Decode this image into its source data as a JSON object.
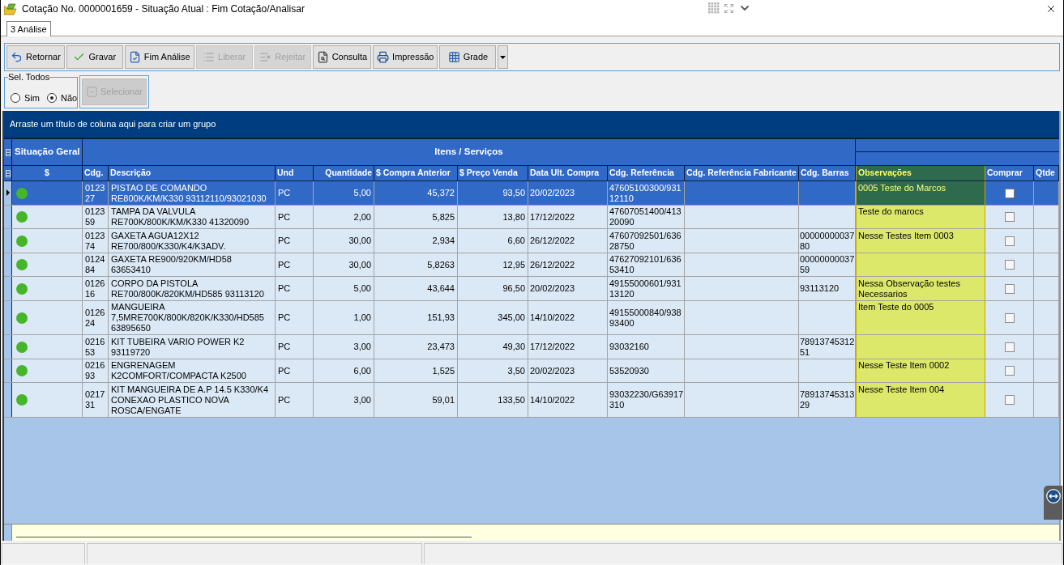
{
  "window": {
    "title": "Cotação No. 0000001659 - Situação Atual : Fim Cotação/Analisar"
  },
  "tabs": [
    {
      "label": "3 Análise",
      "selected": true
    }
  ],
  "toolbar": {
    "buttons": [
      {
        "label": "Retornar",
        "disabled": false
      },
      {
        "label": "Gravar",
        "disabled": false
      },
      {
        "label": "Fim Análise",
        "disabled": false
      },
      {
        "label": "Liberar",
        "disabled": true
      },
      {
        "label": "Rejeitar",
        "disabled": true
      },
      {
        "label": "Consulta",
        "disabled": false
      },
      {
        "label": "Impressão",
        "disabled": false
      },
      {
        "label": "Grade",
        "disabled": false
      }
    ]
  },
  "select_all": {
    "legend": "Sel. Todos",
    "options": [
      {
        "label": "Sim",
        "selected": false
      },
      {
        "label": "Não",
        "selected": true
      }
    ]
  },
  "select_button": {
    "label": "Selecionar",
    "disabled": true
  },
  "grid": {
    "group_hint": "Arraste um título de coluna aqui para criar um grupo",
    "bands": [
      {
        "label": "Situação Geral"
      },
      {
        "label": "Itens / Serviços"
      }
    ],
    "columns": [
      {
        "label": "$",
        "highlighted": false
      },
      {
        "label": "Cdg.",
        "highlighted": false
      },
      {
        "label": "Descrição",
        "highlighted": false
      },
      {
        "label": "Und",
        "highlighted": false
      },
      {
        "label": "Quantidade",
        "highlighted": false
      },
      {
        "label": "$ Compra Anterior",
        "highlighted": false
      },
      {
        "label": "$ Preço Venda",
        "highlighted": false
      },
      {
        "label": "Data Ult. Compra",
        "highlighted": false
      },
      {
        "label": "Cdg. Referência",
        "highlighted": false
      },
      {
        "label": "Cdg. Referência Fabricante",
        "highlighted": false
      },
      {
        "label": "Cdg. Barras",
        "highlighted": false
      },
      {
        "label": "Observações",
        "highlighted": true
      },
      {
        "label": "Comprar",
        "highlighted": false
      },
      {
        "label": "Qtde",
        "highlighted": false
      }
    ],
    "rows": [
      {
        "selected": true,
        "color": "#47b52a",
        "code": "012327",
        "description": "PISTAO DE COMANDO\nRE800K/KM/K330 93112110/93021030",
        "unit": "PC",
        "quantity": "5,00",
        "last_purchase_price": "45,372",
        "sale_price": "93,50",
        "last_purchase_date": "20/02/2023",
        "reference": "47605100300/93112110",
        "notes": "0005 Teste do Marcos",
        "buy": false
      },
      {
        "selected": false,
        "color": "#47b52a",
        "code": "012359",
        "description": "TAMPA DA VALVULA\nRE700K/800K/KM/K330 41320090",
        "unit": "PC",
        "quantity": "2,00",
        "last_purchase_price": "5,825",
        "sale_price": "13,80",
        "last_purchase_date": "17/12/2022",
        "reference": "47607051400/41320090",
        "notes": "Teste do marocs",
        "buy": false
      },
      {
        "selected": false,
        "color": "#47b52a",
        "code": "012374",
        "description": "GAXETA AGUA12X12\nRE700/800/K330/K4/K3ADV.",
        "unit": "PC",
        "quantity": "30,00",
        "last_purchase_price": "2,934",
        "sale_price": "6,60",
        "last_purchase_date": "26/12/2022",
        "reference": "47607092501/63628750",
        "barcode": "0000000003780",
        "notes": "Nesse Testes Item 0003",
        "buy": false
      },
      {
        "selected": false,
        "color": "#47b52a",
        "code": "012484",
        "description": "GAXETA RE900/920KM/HD58\n63653410",
        "unit": "PC",
        "quantity": "30,00",
        "last_purchase_price": "5,8263",
        "sale_price": "12,95",
        "last_purchase_date": "26/12/2022",
        "reference": "47627092101/63653410",
        "barcode": "0000000003759",
        "buy": false
      },
      {
        "selected": false,
        "color": "#47b52a",
        "code": "012616",
        "description": "CORPO DA PISTOLA\nRE700/800K/820KM/HD585 93113120",
        "unit": "PC",
        "quantity": "5,00",
        "last_purchase_price": "43,644",
        "sale_price": "96,50",
        "last_purchase_date": "20/02/2023",
        "reference": "49155000601/93113120",
        "barcode": "93113120",
        "notes": "Nessa Observação testes Necessarios",
        "buy": false
      },
      {
        "selected": false,
        "color": "#47b52a",
        "code": "012624",
        "description": "MANGUEIRA\n7,5MRE700K/800K/820K/K330/HD585\n63895650",
        "unit": "PC",
        "quantity": "1,00",
        "last_purchase_price": "151,93",
        "sale_price": "345,00",
        "last_purchase_date": "14/10/2022",
        "reference": "49155000840/93893400",
        "notes": "Item Teste do 0005",
        "buy": false
      },
      {
        "selected": false,
        "color": "#47b52a",
        "code": "021653",
        "description": "KIT TUBEIRA VARIO POWER K2\n93119720",
        "unit": "PC",
        "quantity": "3,00",
        "last_purchase_price": "23,473",
        "sale_price": "49,30",
        "last_purchase_date": "17/12/2022",
        "reference": "93032160",
        "barcode": "7891374531251",
        "buy": false
      },
      {
        "selected": false,
        "color": "#47b52a",
        "code": "021693",
        "description": "ENGRENAGEM\nK2COMFORT/COMPACTA K2500",
        "unit": "PC",
        "quantity": "6,00",
        "last_purchase_price": "1,525",
        "sale_price": "3,50",
        "last_purchase_date": "20/02/2023",
        "reference": "53520930",
        "notes": "Nesse Teste Item 0002",
        "buy": false
      },
      {
        "selected": false,
        "color": "#47b52a",
        "code": "021731",
        "description": "KIT MANGUEIRA DE A.P 14.5 K330/K4\nCONEXAO PLASTICO NOVA\nROSCA/ENGATE",
        "unit": "PC",
        "quantity": "3,00",
        "last_purchase_price": "59,01",
        "sale_price": "133,50",
        "last_purchase_date": "14/10/2022",
        "reference": "93032230/G63917310",
        "barcode": "7891374531329",
        "notes": "Nesse Teste Item 004",
        "buy": false
      }
    ]
  }
}
